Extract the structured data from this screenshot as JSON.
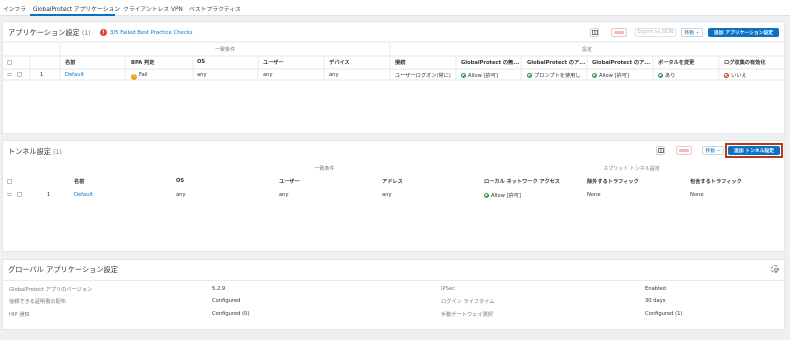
{
  "tabs": [
    "インフラ",
    "GlobalProtect アプリケーション",
    "クライアントレス VPN",
    "ベストプラクティス"
  ],
  "app_settings": {
    "title": "アプリケーション設定",
    "count": "(1)",
    "failed_checks": "3/5 Failed Best Practice Checks",
    "toolbar": {
      "export_label": "Export as JSON",
      "move_label": "移動",
      "add_label": "追加 アプリケーション設定"
    },
    "group_headers": {
      "match": "一致条件",
      "settings": "設定"
    },
    "columns": [
      "名前",
      "BPA 判定",
      "OS",
      "ユーザー",
      "デバイス",
      "接続",
      "GlobalProtect の無...",
      "GlobalProtect のア...",
      "GlobalProtect のア...",
      "ポータルを変更",
      "ログ収集の有効化"
    ],
    "rows": [
      {
        "index": "1",
        "name": "Default",
        "bpa": "Fail",
        "os": "any",
        "user": "any",
        "device": "any",
        "connect": "ユーザーログオン(常に)",
        "gp_disable": "Allow [許可]",
        "gp_app1": "プロンプトを使用し",
        "gp_app2": "Allow [許可]",
        "portal_change": "あり",
        "log_collect": "いいえ"
      }
    ]
  },
  "tunnel_settings": {
    "title": "トンネル設定",
    "count": "(1)",
    "toolbar": {
      "move_label": "移動",
      "add_label": "追加 トンネル設定"
    },
    "group_headers": {
      "match": "一致条件",
      "split": "スプリット トンネル設定"
    },
    "columns": [
      "名前",
      "OS",
      "ユーザー",
      "アドレス",
      "ローカル ネットワーク アクセス",
      "除外するトラフィック",
      "包含するトラフィック"
    ],
    "rows": [
      {
        "index": "1",
        "name": "Default",
        "os": "any",
        "user": "any",
        "address": "any",
        "local_access": "Allow [許可]",
        "exclude": "None",
        "include": "None"
      }
    ]
  },
  "global_settings": {
    "title": "グローバル アプリケーション設定",
    "items": [
      {
        "label": "GlobalProtect アプリのバージョン",
        "value": "5.2.9"
      },
      {
        "label": "IPSec",
        "value": "Enabled"
      },
      {
        "label": "信頼できる証明書の配布",
        "value": "Configured"
      },
      {
        "label": "ログイン ライフタイム",
        "value": "30 days"
      },
      {
        "label": "HIP 通知",
        "value": "Configured (0)"
      },
      {
        "label": "手動ゲートウェイ選択",
        "value": "Configured (1)"
      }
    ]
  },
  "colors": {
    "accent": "#0a72c5",
    "error": "#e0413b",
    "warning": "#f09f1a",
    "success": "#2e9a4a",
    "highlight": "#b53a1a"
  }
}
